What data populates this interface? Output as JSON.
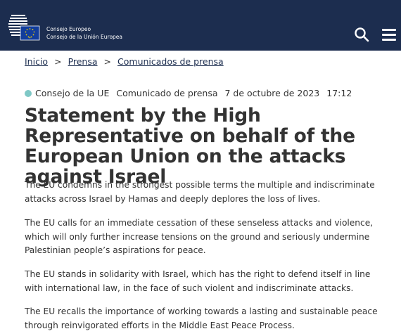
{
  "header": {
    "logo_line1": "Consejo Europeo",
    "logo_line2": "Consejo de la Unión Europea",
    "brand_color": "#1c2d4f",
    "search_icon": "search-icon",
    "menu_icon": "hamburger-menu-icon"
  },
  "breadcrumb": {
    "items": [
      "Inicio",
      "Prensa",
      "Comunicados de prensa"
    ],
    "separator": ">"
  },
  "meta": {
    "institution": "Consejo de la UE",
    "type": "Comunicado de prensa",
    "date": "7 de octubre de 2023",
    "time": "17:12",
    "dot_color": "#7fc8c6"
  },
  "article": {
    "title": "Statement by the High Representative on behalf of the European Union on the attacks against Israel",
    "paragraphs": [
      "The EU condemns in the strongest possible terms the multiple and indiscriminate attacks across Israel by Hamas and deeply deplores the loss of lives.",
      "The EU calls for an immediate cessation of these senseless attacks and violence, which will only further increase tensions on the ground and seriously undermine Palestinian people’s aspirations for peace.",
      "The EU stands in solidarity with Israel, which has the right to defend itself in line with international law, in the face of such violent and indiscriminate attacks.",
      "The EU recalls the importance of working towards a lasting and sustainable peace through reinvigorated efforts in the Middle East Peace Process."
    ]
  }
}
